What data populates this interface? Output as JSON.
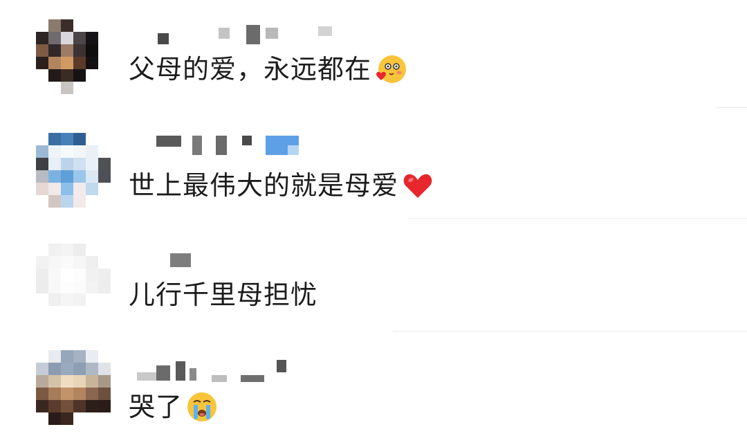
{
  "comments": [
    {
      "text": "父母的爱，永远都在",
      "emoji": "blush-heart-emoji"
    },
    {
      "text": "世上最伟大的就是母爱",
      "emoji": "red-heart-emoji"
    },
    {
      "text": "儿行千里母担忧",
      "emoji": ""
    },
    {
      "text": "哭了",
      "emoji": "crying-face-emoji"
    }
  ],
  "colors": {
    "text": "#1c1c1c",
    "heart": "#e8262e",
    "emoji_face": "#f9c43b"
  }
}
